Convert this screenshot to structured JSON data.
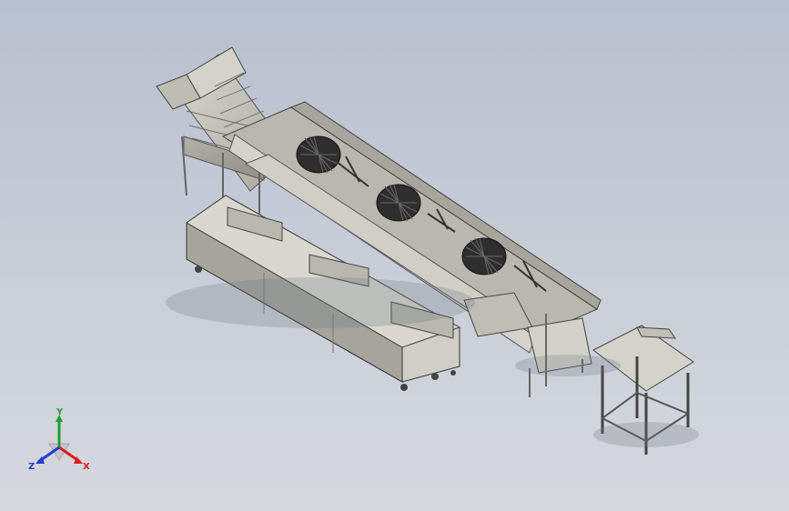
{
  "triad": {
    "x_label": "X",
    "y_label": "Y",
    "z_label": "Z"
  },
  "colors": {
    "background_top": "#b7c0cf",
    "background_bottom": "#d6d9de",
    "machine_metal": "#c8c8bd",
    "machine_shadow": "#7d7d74",
    "x_axis": "#e01b1b",
    "y_axis": "#1f9f2f",
    "z_axis": "#1f3fd0"
  }
}
